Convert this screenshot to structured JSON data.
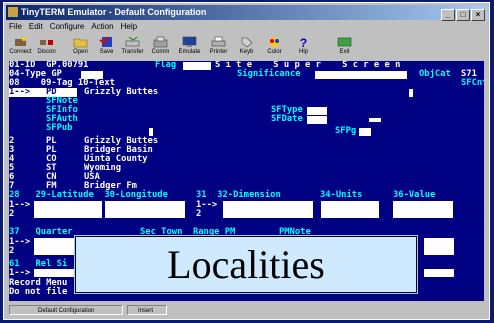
{
  "window": {
    "title": "TinyTERM Emulator - Default Configuration",
    "controls": [
      "_",
      "□",
      "×"
    ]
  },
  "menu": [
    "File",
    "Edit",
    "Configure",
    "Action",
    "Help"
  ],
  "toolbar": [
    {
      "label": "Connect",
      "icon": "connect-icon"
    },
    {
      "label": "Discon",
      "icon": "disconnect-icon"
    },
    {
      "label": "Open",
      "icon": "open-folder-icon"
    },
    {
      "label": "Save",
      "icon": "save-icon"
    },
    {
      "label": "Transfer",
      "icon": "transfer-icon"
    },
    {
      "label": "Comm",
      "icon": "comm-icon"
    },
    {
      "label": "Emulate",
      "icon": "emulate-icon"
    },
    {
      "label": "Printer",
      "icon": "printer-icon"
    },
    {
      "label": "Keyb",
      "icon": "keyboard-icon"
    },
    {
      "label": "Color",
      "icon": "color-icon"
    },
    {
      "label": "Hlp",
      "icon": "help-icon"
    },
    {
      "label": "Exit",
      "icon": "exit-icon"
    }
  ],
  "terminal": {
    "l01_a": "01-ID  GP.00791",
    "l01_flag": "Flag",
    "l01_site": "S i t e    S u p e r    S c r e e n",
    "l02_a": "04-Type GP",
    "l02_sig": "Significance",
    "l02_obj": "ObjCat",
    "l02_objval": "S71",
    "l03_a": "08    09-Tag 10-Text",
    "l03_sfcnt": "SFCnt",
    "l04_a": "1-->",
    "l04_tag": "PD",
    "l04_text": "Grizzly Buttes",
    "sf_labels": [
      "SFNote",
      "SFInfo",
      "SFAuth",
      "SFPub"
    ],
    "sftype": "SFType",
    "sfdate": "SFDate",
    "sfpg": "SFPg",
    "rows": [
      {
        "n": "2",
        "tag": "PL",
        "text": "Grizzly Buttes"
      },
      {
        "n": "3",
        "tag": "PL",
        "text": "Bridger Basin"
      },
      {
        "n": "4",
        "tag": "CO",
        "text": "Uinta County"
      },
      {
        "n": "5",
        "tag": "ST",
        "text": "Wyoming"
      },
      {
        "n": "6",
        "tag": "CN",
        "text": "USA"
      },
      {
        "n": "7",
        "tag": "FM",
        "text": "Bridger Fm"
      }
    ],
    "hdr28": "28   29-Latitude  30-Longitude",
    "hdr31": "31  32-Dimension",
    "hdr34": "34-Units",
    "hdr36": "36-Value",
    "arrow": "1-->",
    "num2": "2",
    "hdr37": "37   Quarter",
    "hdrsec": "Sec Town  Range PM",
    "hdrpm": "PMNote",
    "hdr61": "61   Rel Si",
    "menu_line": "Record Menu",
    "notfile": "Do not file"
  },
  "overlay_title": "Localities",
  "status": {
    "config": "Default Configuration",
    "mode": "Insert"
  }
}
